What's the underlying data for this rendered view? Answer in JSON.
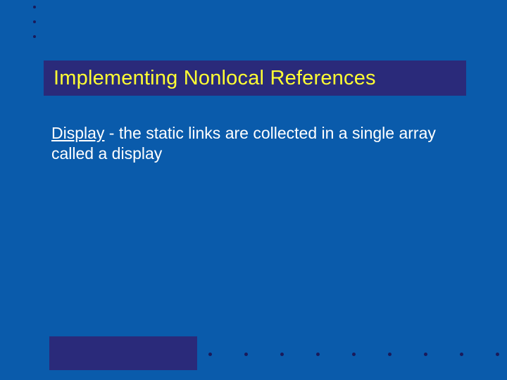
{
  "title": "Implementing Nonlocal References",
  "body": {
    "term": "Display",
    "definition": " - the static links are collected in a single array called a display"
  },
  "colors": {
    "background": "#0a5bab",
    "accent": "#2a2a7a",
    "title_text": "#ffff33",
    "body_text": "#ffffff"
  }
}
